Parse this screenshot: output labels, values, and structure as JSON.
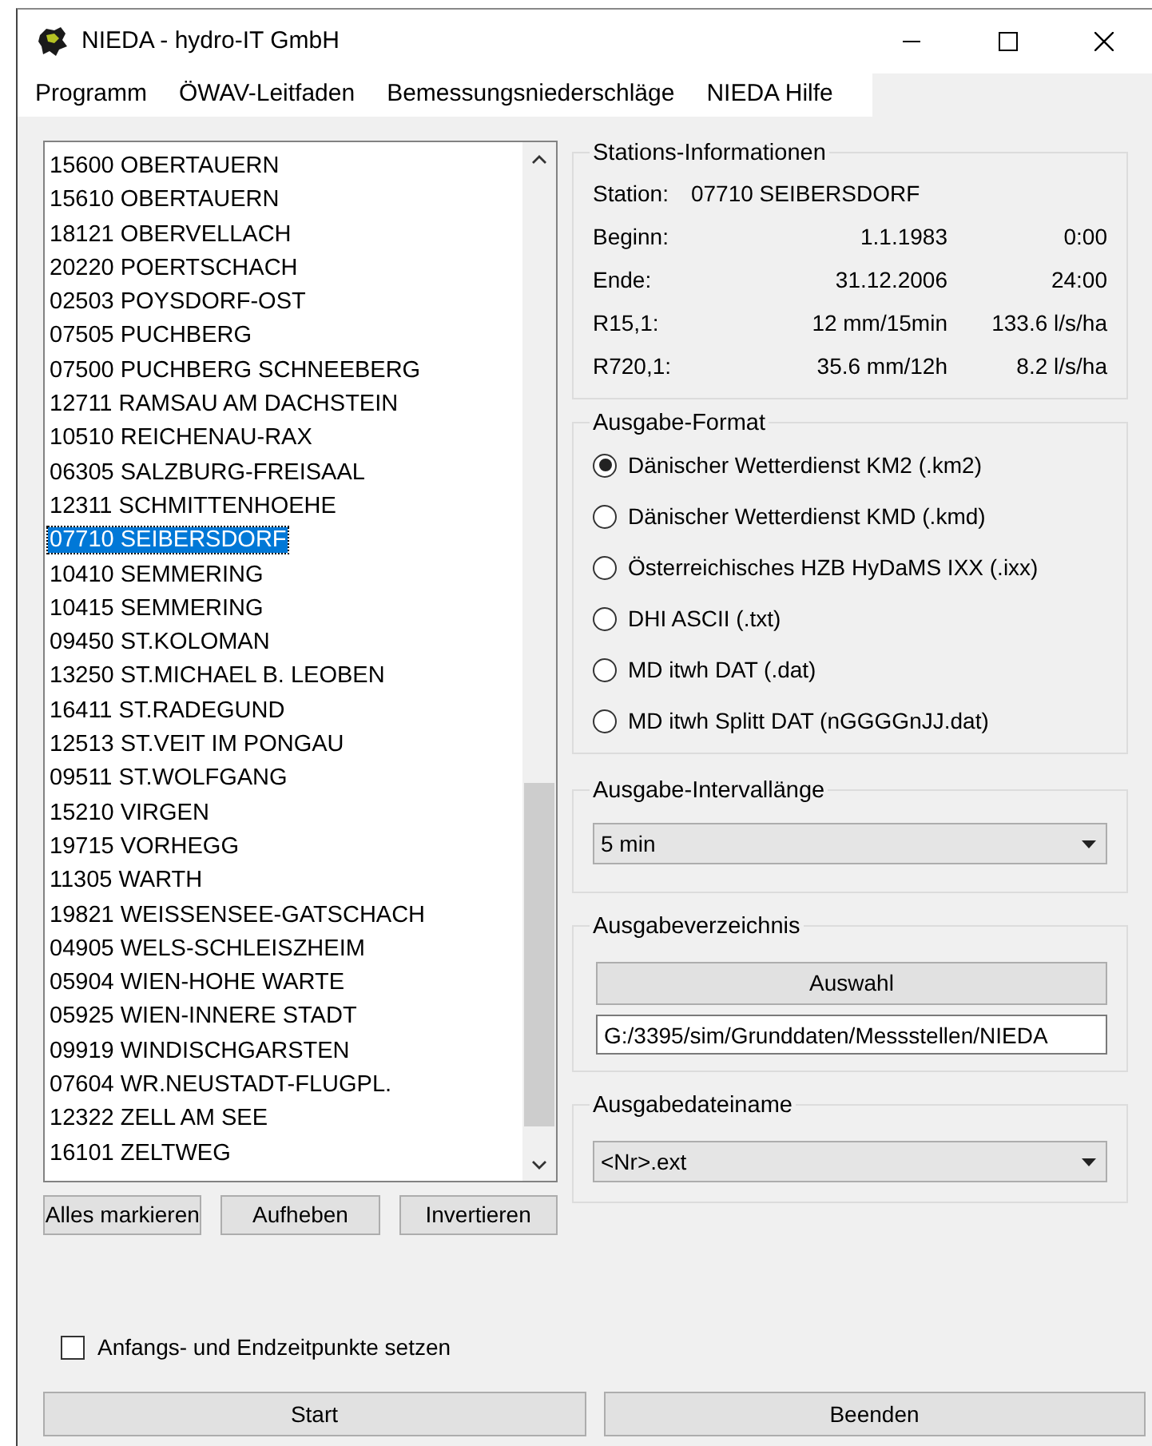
{
  "window": {
    "title": "NIEDA - hydro-IT GmbH"
  },
  "menu": [
    "Programm",
    "ÖWAV-Leitfaden",
    "Bemessungsniederschläge",
    "NIEDA Hilfe"
  ],
  "stations": [
    {
      "label": "15600 OBERTAUERN",
      "selected": false
    },
    {
      "label": "15610 OBERTAUERN",
      "selected": false
    },
    {
      "label": "18121 OBERVELLACH",
      "selected": false
    },
    {
      "label": "20220 POERTSCHACH",
      "selected": false
    },
    {
      "label": "02503 POYSDORF-OST",
      "selected": false
    },
    {
      "label": "07505 PUCHBERG",
      "selected": false
    },
    {
      "label": "07500 PUCHBERG SCHNEEBERG",
      "selected": false
    },
    {
      "label": "12711 RAMSAU AM DACHSTEIN",
      "selected": false
    },
    {
      "label": "10510 REICHENAU-RAX",
      "selected": false
    },
    {
      "label": "06305 SALZBURG-FREISAAL",
      "selected": false
    },
    {
      "label": "12311 SCHMITTENHOEHE",
      "selected": false
    },
    {
      "label": "07710 SEIBERSDORF",
      "selected": true
    },
    {
      "label": "10410 SEMMERING",
      "selected": false
    },
    {
      "label": "10415 SEMMERING",
      "selected": false
    },
    {
      "label": "09450 ST.KOLOMAN",
      "selected": false
    },
    {
      "label": "13250 ST.MICHAEL B. LEOBEN",
      "selected": false
    },
    {
      "label": "16411 ST.RADEGUND",
      "selected": false
    },
    {
      "label": "12513 ST.VEIT IM PONGAU",
      "selected": false
    },
    {
      "label": "09511 ST.WOLFGANG",
      "selected": false
    },
    {
      "label": "15210 VIRGEN",
      "selected": false
    },
    {
      "label": "19715 VORHEGG",
      "selected": false
    },
    {
      "label": "11305 WARTH",
      "selected": false
    },
    {
      "label": "19821 WEISSENSEE-GATSCHACH",
      "selected": false
    },
    {
      "label": "04905 WELS-SCHLEISZHEIM",
      "selected": false
    },
    {
      "label": "05904 WIEN-HOHE WARTE",
      "selected": false
    },
    {
      "label": "05925 WIEN-INNERE STADT",
      "selected": false
    },
    {
      "label": "09919 WINDISCHGARSTEN",
      "selected": false
    },
    {
      "label": "07604 WR.NEUSTADT-FLUGPL.",
      "selected": false
    },
    {
      "label": "12322 ZELL AM SEE",
      "selected": false
    },
    {
      "label": "16101 ZELTWEG",
      "selected": false
    }
  ],
  "list_buttons": [
    "Alles markieren",
    "Aufheben",
    "Invertieren"
  ],
  "station_info": {
    "title": "Stations-Informationen",
    "station_label": "Station:",
    "station_value": "07710 SEIBERSDORF",
    "rows": [
      {
        "label": "Beginn:",
        "value_1": "1.1.1983",
        "value_2": "0:00"
      },
      {
        "label": "Ende:",
        "value_1": "31.12.2006",
        "value_2": "24:00"
      },
      {
        "label": "R15,1:",
        "value_1": "12 mm/15min",
        "value_2": "133.6 l/s/ha"
      },
      {
        "label": "R720,1:",
        "value_1": "35.6 mm/12h",
        "value_2": "8.2 l/s/ha"
      }
    ]
  },
  "output_format": {
    "title": "Ausgabe-Format",
    "options": [
      {
        "label": "Dänischer Wetterdienst KM2 (.km2)",
        "selected": true
      },
      {
        "label": "Dänischer Wetterdienst KMD (.kmd)",
        "selected": false
      },
      {
        "label": "Österreichisches HZB HyDaMS IXX (.ixx)",
        "selected": false
      },
      {
        "label": "DHI ASCII (.txt)",
        "selected": false
      },
      {
        "label": "MD itwh DAT (.dat)",
        "selected": false
      },
      {
        "label": "MD itwh Splitt DAT (nGGGGnJJ.dat)",
        "selected": false
      }
    ]
  },
  "interval": {
    "title": "Ausgabe-Intervallänge",
    "value": "5 min"
  },
  "output_dir": {
    "title": "Ausgabeverzeichnis",
    "button": "Auswahl",
    "value": "G:/3395/sim/Grunddaten/Messstellen/NIEDA"
  },
  "output_file": {
    "title": "Ausgabedateiname",
    "value": "<Nr>.ext"
  },
  "set_times": {
    "label": "Anfangs- und Endzeitpunkte setzen",
    "checked": false
  },
  "buttons": [
    "Start",
    "Beenden"
  ]
}
